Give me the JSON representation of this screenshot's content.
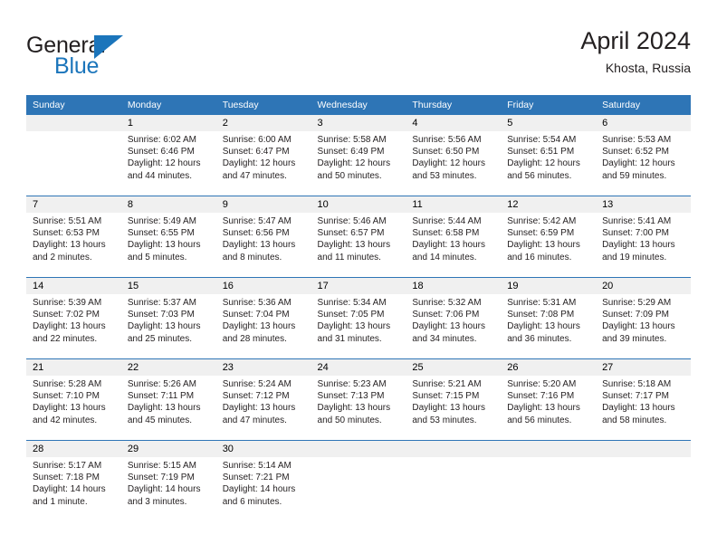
{
  "brand": {
    "name_top": "General",
    "name_bottom": "Blue",
    "flag_color": "#1b75bb"
  },
  "header": {
    "month_title": "April 2024",
    "location": "Khosta, Russia"
  },
  "theme": {
    "header_blue": "#2e75b6",
    "daynum_band": "#f0f0f0",
    "text": "#231f20"
  },
  "calendar": {
    "weekday_headers": [
      "Sunday",
      "Monday",
      "Tuesday",
      "Wednesday",
      "Thursday",
      "Friday",
      "Saturday"
    ],
    "weeks": [
      [
        {
          "day": "",
          "sunrise": "",
          "sunset": "",
          "daylight": "",
          "empty": true
        },
        {
          "day": "1",
          "sunrise": "Sunrise: 6:02 AM",
          "sunset": "Sunset: 6:46 PM",
          "daylight": "Daylight: 12 hours and 44 minutes."
        },
        {
          "day": "2",
          "sunrise": "Sunrise: 6:00 AM",
          "sunset": "Sunset: 6:47 PM",
          "daylight": "Daylight: 12 hours and 47 minutes."
        },
        {
          "day": "3",
          "sunrise": "Sunrise: 5:58 AM",
          "sunset": "Sunset: 6:49 PM",
          "daylight": "Daylight: 12 hours and 50 minutes."
        },
        {
          "day": "4",
          "sunrise": "Sunrise: 5:56 AM",
          "sunset": "Sunset: 6:50 PM",
          "daylight": "Daylight: 12 hours and 53 minutes."
        },
        {
          "day": "5",
          "sunrise": "Sunrise: 5:54 AM",
          "sunset": "Sunset: 6:51 PM",
          "daylight": "Daylight: 12 hours and 56 minutes."
        },
        {
          "day": "6",
          "sunrise": "Sunrise: 5:53 AM",
          "sunset": "Sunset: 6:52 PM",
          "daylight": "Daylight: 12 hours and 59 minutes."
        }
      ],
      [
        {
          "day": "7",
          "sunrise": "Sunrise: 5:51 AM",
          "sunset": "Sunset: 6:53 PM",
          "daylight": "Daylight: 13 hours and 2 minutes."
        },
        {
          "day": "8",
          "sunrise": "Sunrise: 5:49 AM",
          "sunset": "Sunset: 6:55 PM",
          "daylight": "Daylight: 13 hours and 5 minutes."
        },
        {
          "day": "9",
          "sunrise": "Sunrise: 5:47 AM",
          "sunset": "Sunset: 6:56 PM",
          "daylight": "Daylight: 13 hours and 8 minutes."
        },
        {
          "day": "10",
          "sunrise": "Sunrise: 5:46 AM",
          "sunset": "Sunset: 6:57 PM",
          "daylight": "Daylight: 13 hours and 11 minutes."
        },
        {
          "day": "11",
          "sunrise": "Sunrise: 5:44 AM",
          "sunset": "Sunset: 6:58 PM",
          "daylight": "Daylight: 13 hours and 14 minutes."
        },
        {
          "day": "12",
          "sunrise": "Sunrise: 5:42 AM",
          "sunset": "Sunset: 6:59 PM",
          "daylight": "Daylight: 13 hours and 16 minutes."
        },
        {
          "day": "13",
          "sunrise": "Sunrise: 5:41 AM",
          "sunset": "Sunset: 7:00 PM",
          "daylight": "Daylight: 13 hours and 19 minutes."
        }
      ],
      [
        {
          "day": "14",
          "sunrise": "Sunrise: 5:39 AM",
          "sunset": "Sunset: 7:02 PM",
          "daylight": "Daylight: 13 hours and 22 minutes."
        },
        {
          "day": "15",
          "sunrise": "Sunrise: 5:37 AM",
          "sunset": "Sunset: 7:03 PM",
          "daylight": "Daylight: 13 hours and 25 minutes."
        },
        {
          "day": "16",
          "sunrise": "Sunrise: 5:36 AM",
          "sunset": "Sunset: 7:04 PM",
          "daylight": "Daylight: 13 hours and 28 minutes."
        },
        {
          "day": "17",
          "sunrise": "Sunrise: 5:34 AM",
          "sunset": "Sunset: 7:05 PM",
          "daylight": "Daylight: 13 hours and 31 minutes."
        },
        {
          "day": "18",
          "sunrise": "Sunrise: 5:32 AM",
          "sunset": "Sunset: 7:06 PM",
          "daylight": "Daylight: 13 hours and 34 minutes."
        },
        {
          "day": "19",
          "sunrise": "Sunrise: 5:31 AM",
          "sunset": "Sunset: 7:08 PM",
          "daylight": "Daylight: 13 hours and 36 minutes."
        },
        {
          "day": "20",
          "sunrise": "Sunrise: 5:29 AM",
          "sunset": "Sunset: 7:09 PM",
          "daylight": "Daylight: 13 hours and 39 minutes."
        }
      ],
      [
        {
          "day": "21",
          "sunrise": "Sunrise: 5:28 AM",
          "sunset": "Sunset: 7:10 PM",
          "daylight": "Daylight: 13 hours and 42 minutes."
        },
        {
          "day": "22",
          "sunrise": "Sunrise: 5:26 AM",
          "sunset": "Sunset: 7:11 PM",
          "daylight": "Daylight: 13 hours and 45 minutes."
        },
        {
          "day": "23",
          "sunrise": "Sunrise: 5:24 AM",
          "sunset": "Sunset: 7:12 PM",
          "daylight": "Daylight: 13 hours and 47 minutes."
        },
        {
          "day": "24",
          "sunrise": "Sunrise: 5:23 AM",
          "sunset": "Sunset: 7:13 PM",
          "daylight": "Daylight: 13 hours and 50 minutes."
        },
        {
          "day": "25",
          "sunrise": "Sunrise: 5:21 AM",
          "sunset": "Sunset: 7:15 PM",
          "daylight": "Daylight: 13 hours and 53 minutes."
        },
        {
          "day": "26",
          "sunrise": "Sunrise: 5:20 AM",
          "sunset": "Sunset: 7:16 PM",
          "daylight": "Daylight: 13 hours and 56 minutes."
        },
        {
          "day": "27",
          "sunrise": "Sunrise: 5:18 AM",
          "sunset": "Sunset: 7:17 PM",
          "daylight": "Daylight: 13 hours and 58 minutes."
        }
      ],
      [
        {
          "day": "28",
          "sunrise": "Sunrise: 5:17 AM",
          "sunset": "Sunset: 7:18 PM",
          "daylight": "Daylight: 14 hours and 1 minute."
        },
        {
          "day": "29",
          "sunrise": "Sunrise: 5:15 AM",
          "sunset": "Sunset: 7:19 PM",
          "daylight": "Daylight: 14 hours and 3 minutes."
        },
        {
          "day": "30",
          "sunrise": "Sunrise: 5:14 AM",
          "sunset": "Sunset: 7:21 PM",
          "daylight": "Daylight: 14 hours and 6 minutes."
        },
        {
          "day": "",
          "sunrise": "",
          "sunset": "",
          "daylight": "",
          "empty": true
        },
        {
          "day": "",
          "sunrise": "",
          "sunset": "",
          "daylight": "",
          "empty": true
        },
        {
          "day": "",
          "sunrise": "",
          "sunset": "",
          "daylight": "",
          "empty": true
        },
        {
          "day": "",
          "sunrise": "",
          "sunset": "",
          "daylight": "",
          "empty": true
        }
      ]
    ]
  }
}
